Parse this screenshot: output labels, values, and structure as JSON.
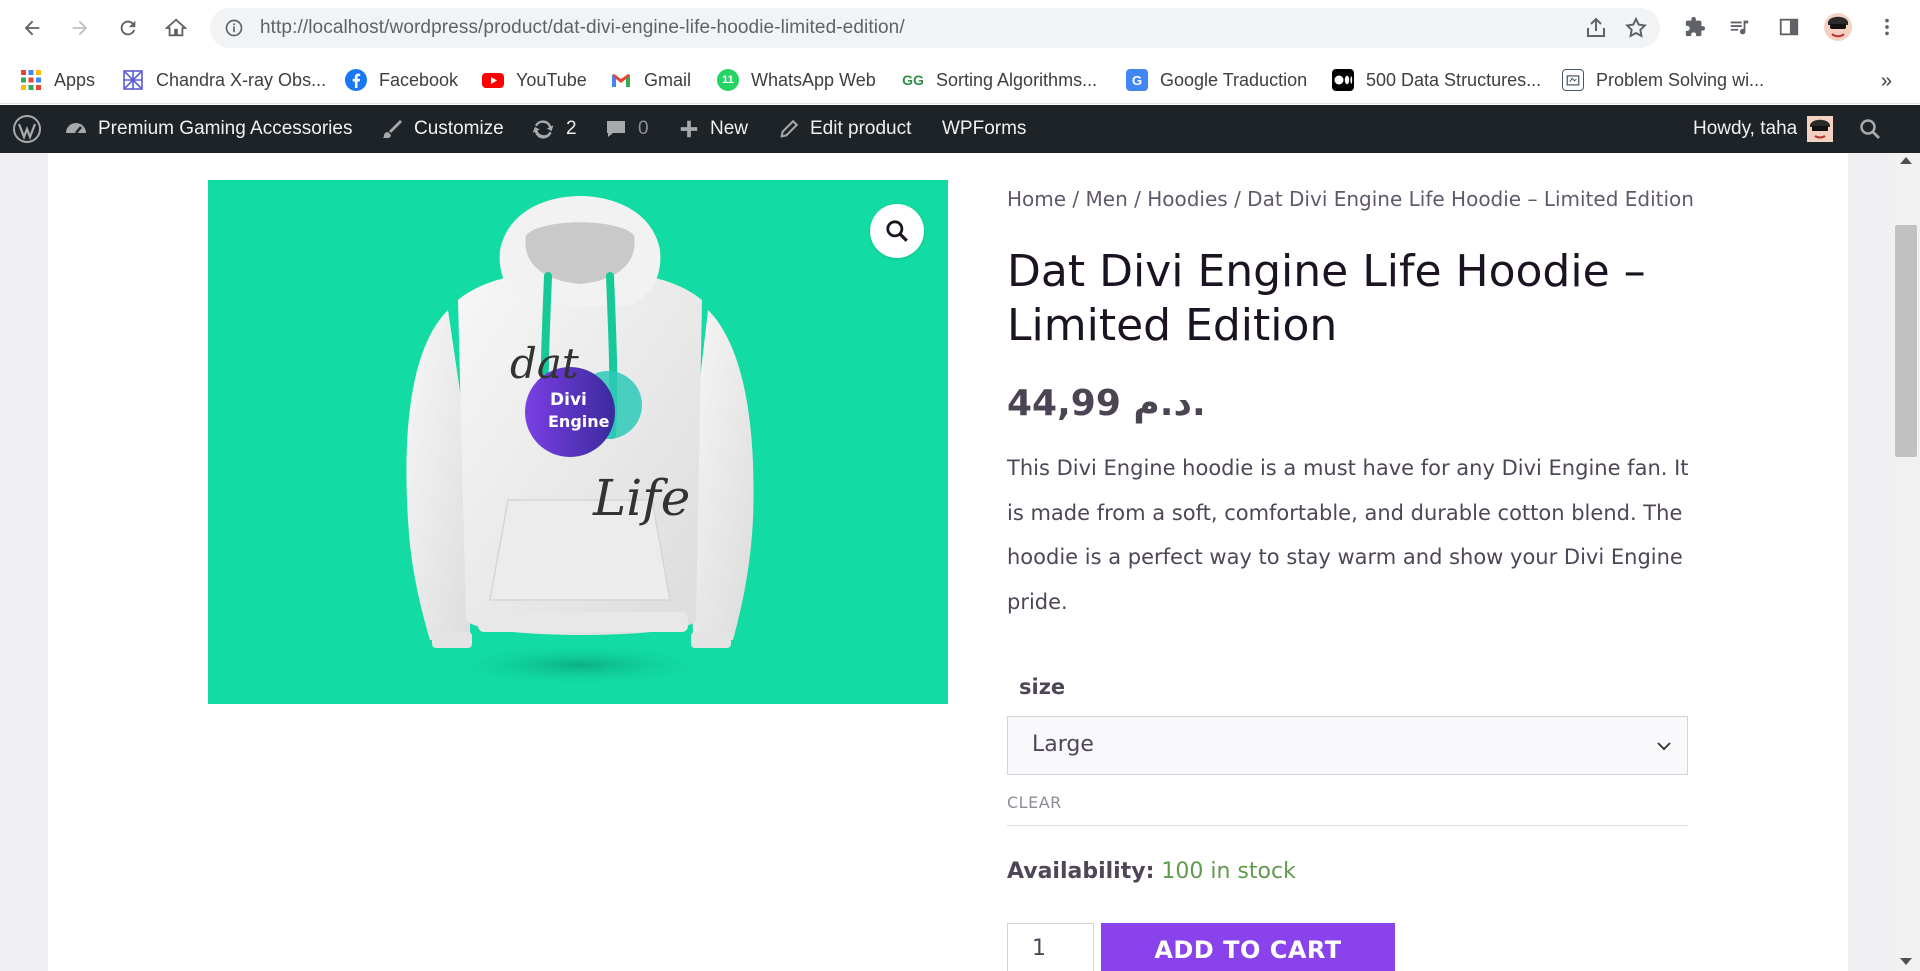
{
  "browser": {
    "url_host": "http://localhost",
    "url_path": "/wordpress/product/dat-divi-engine-life-hoodie-limited-edition/"
  },
  "bookmarks": [
    {
      "label": "Apps",
      "icon": "apps-grid-icon"
    },
    {
      "label": "Chandra X-ray Obs...",
      "icon": "chandra-icon"
    },
    {
      "label": "Facebook",
      "icon": "facebook-icon"
    },
    {
      "label": "YouTube",
      "icon": "youtube-icon"
    },
    {
      "label": "Gmail",
      "icon": "gmail-icon"
    },
    {
      "label": "WhatsApp Web",
      "icon": "whatsapp-icon"
    },
    {
      "label": "Sorting Algorithms...",
      "icon": "geeksforgeeks-icon"
    },
    {
      "label": "Google Traduction",
      "icon": "google-translate-icon"
    },
    {
      "label": "500 Data Structures...",
      "icon": "medium-icon"
    },
    {
      "label": "Problem Solving wi...",
      "icon": "book-icon"
    }
  ],
  "bookmarks_more": "»",
  "adminbar": {
    "site_name": "Premium Gaming Accessories",
    "customize": "Customize",
    "updates_count": "2",
    "comments_count": "0",
    "new": "New",
    "edit_product": "Edit product",
    "wpforms": "WPForms",
    "howdy": "Howdy, taha"
  },
  "product": {
    "breadcrumb": {
      "home": "Home",
      "sep": " / ",
      "men": "Men",
      "hoodies": "Hoodies",
      "current": "Dat Divi Engine Life Hoodie – Limited Edition"
    },
    "title": "Dat Divi Engine Life Hoodie – Limited Edition",
    "price": "44,99 د.م.",
    "description": "This Divi Engine hoodie is a must have for any Divi Engine fan. It is made from a soft, comfortable, and durable cotton blend. The hoodie is a perfect way to stay warm and show your Divi Engine pride.",
    "size_label": "size",
    "size_selected": "Large",
    "clear": "CLEAR",
    "availability_label": "Availability:",
    "availability_value": "100 in stock",
    "quantity": "1",
    "add_to_cart": "ADD TO CART",
    "image_text": {
      "dat": "dat",
      "divi": "Divi",
      "engine": "Engine",
      "life": "Life"
    }
  },
  "colors": {
    "image_bg": "#12dca3",
    "button": "#8a42ed",
    "admin_bar": "#1d2327",
    "stock": "#5f9a4f"
  }
}
